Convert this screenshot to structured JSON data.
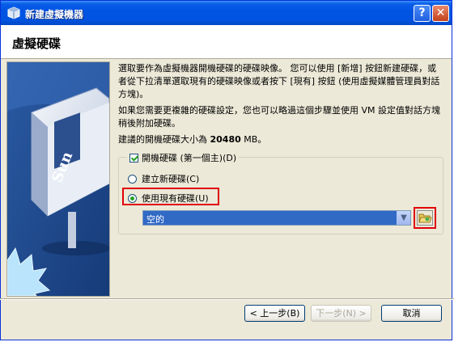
{
  "window": {
    "title": "新建虛擬機器",
    "help_label": "?",
    "close_label": "✕"
  },
  "header": {
    "title": "虛擬硬碟"
  },
  "body": {
    "para1": "選取要作為虛擬機器開機硬碟的硬碟映像。 您可以使用 [新增] 按鈕新建硬碟，或者從下拉清單選取現有的硬碟映像或者按下 [現有] 按鈕 (使用虛擬媒體管理員對話方塊)。",
    "para2": "如果您需要更複雜的硬碟設定，您也可以略過這個步驟並使用 VM 設定值對話方塊稍後附加硬碟。",
    "size_prefix": "建議的開機硬碟大小為 ",
    "size_value": "20480",
    "size_suffix": " MB。"
  },
  "group": {
    "checkbox_label": "開機硬碟 (第一個主)(D)",
    "radio_new_label": "建立新硬碟(C)",
    "radio_existing_label": "使用現有硬碟(U)",
    "combo_value": "空的"
  },
  "buttons": {
    "back": "< 上一步(B)",
    "next": "下一步(N) >",
    "cancel": "取消"
  },
  "colors": {
    "highlight": "#e0000a",
    "selection": "#316ac5"
  }
}
